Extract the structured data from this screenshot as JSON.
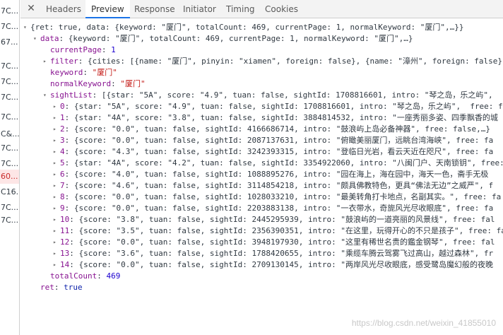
{
  "left_rows": [
    "7C...",
    "7C...",
    "67...",
    "7C...",
    "7C...",
    "7C...",
    "7C...",
    "C&...",
    "7C...",
    "7C...",
    "60...",
    "C16...",
    "7C...",
    "7C..."
  ],
  "tabs": [
    "Headers",
    "Preview",
    "Response",
    "Initiator",
    "Timing",
    "Cookies"
  ],
  "active_tab": "Preview",
  "lines": [
    {
      "arrow": "▾",
      "html": "{ret: true, data: {keyword: \"厦门\", totalCount: 469, currentPage: 1, normalKeyword: \"厦门\",…}}"
    },
    {
      "arrow": "▾",
      "key": "data",
      "rest": ": {keyword: \"厦门\", totalCount: 469, currentPage: 1, normalKeyword: \"厦门\",…}"
    },
    {
      "key": "currentPage",
      "num": "1"
    },
    {
      "arrow": "▸",
      "key": "filter",
      "rest": ": {cities: [{name: \"厦门\", pinyin: \"xiamen\", foreign: false}, {name: \"漳州\", foreign: false},…"
    },
    {
      "key": "keyword",
      "str": "\"厦门\""
    },
    {
      "key": "normalKeyword",
      "str": "\"厦门\""
    },
    {
      "arrow": "▾",
      "key": "sightList",
      "rest": ": [{star: \"5A\", score: \"4.9\", tuan: false, sightId: 1708816601, intro: \"琴之岛，乐之屿\","
    },
    {
      "arrow": "▸",
      "key": "0",
      "rest": ": {star: \"5A\", score: \"4.9\", tuan: false, sightId: 1708816601, intro: \"琴之岛，乐之屿\",  free: f"
    },
    {
      "arrow": "▸",
      "key": "1",
      "rest": ": {star: \"4A\", score: \"3.8\", tuan: false, sightId: 3884814532, intro: \"一座秀丽多姿、四季飘香的城"
    },
    {
      "arrow": "▸",
      "key": "2",
      "rest": ": {score: \"0.0\", tuan: false, sightId: 4166686714, intro: \"鼓浪屿上岛必备神器\", free: false,…}"
    },
    {
      "arrow": "▸",
      "key": "3",
      "rest": ": {score: \"0.0\", tuan: false, sightId: 2087137631, intro: \"俯瞰美丽厦门，远眺台湾海峡\", free: fa"
    },
    {
      "arrow": "▸",
      "key": "4",
      "rest": ": {score: \"4.3\", tuan: false, sightId: 3242393315, intro: \"登临日光岩，看云天近在咫尺\", free: fa"
    },
    {
      "arrow": "▸",
      "key": "5",
      "rest": ": {star: \"4A\", score: \"4.2\", tuan: false, sightId: 3354922060, intro: \"八闽门户、天南锁钥\", free:"
    },
    {
      "arrow": "▸",
      "key": "6",
      "rest": ": {score: \"4.0\", tuan: false, sightId: 1088895276, intro: \"园在海上，海在园中，海天一色，斋手无极"
    },
    {
      "arrow": "▸",
      "key": "7",
      "rest": ": {score: \"4.6\", tuan: false, sightId: 3114854218, intro: \"颇具佛教特色，更具“佛法无边”之威严\", f"
    },
    {
      "arrow": "▸",
      "key": "8",
      "rest": ": {score: \"0.0\", tuan: false, sightId: 1028033210, intro: \"最美转角打卡地点，名副其实。\", free: fa"
    },
    {
      "arrow": "▸",
      "key": "9",
      "rest": ": {score: \"0.0\", tuan: false, sightId: 2203883138, intro: \"一衣带水，奇旎风光尽收眼底\", free: fa"
    },
    {
      "arrow": "▸",
      "key": "10",
      "rest": ": {score: \"3.8\", tuan: false, sightId: 2445295939, intro: \"鼓浪屿的一道亮丽的风景线\", free: fal"
    },
    {
      "arrow": "▸",
      "key": "11",
      "rest": ": {score: \"3.5\", tuan: false, sightId: 2356390351, intro: \"在这里，玩得开心的不只是孩子\", free: fal"
    },
    {
      "arrow": "▸",
      "key": "12",
      "rest": ": {score: \"0.0\", tuan: false, sightId: 3948197930, intro: \"这里有稀世名贵的鑑金钢琴\", free: fal"
    },
    {
      "arrow": "▸",
      "key": "13",
      "rest": ": {score: \"3.6\", tuan: false, sightId: 1788420655, intro: \"乘缆车腾云驾雾飞过高山，越过森林\", fr"
    },
    {
      "arrow": "▸",
      "key": "14",
      "rest": ": {score: \"0.0\", tuan: false, sightId: 2709130145, intro: \"两岸风光尽收眼底，感受鹭岛魔幻般的夜晚"
    },
    {
      "key": "totalCount",
      "num": "469"
    },
    {
      "key": "ret",
      "bool": "true"
    }
  ],
  "watermark": "https://blog.csdn.net/weixin_41855010"
}
